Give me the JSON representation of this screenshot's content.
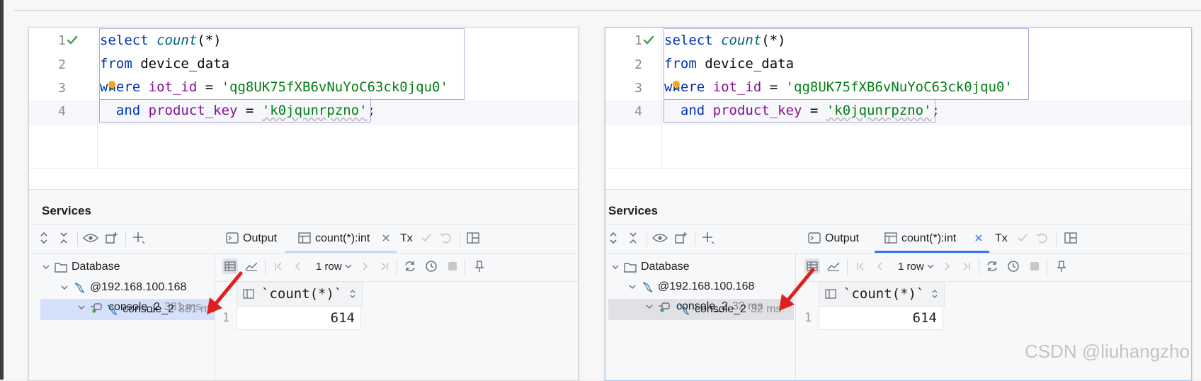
{
  "panels": [
    {
      "id": "left",
      "editor": {
        "line_numbers": [
          "1",
          "2",
          "3",
          "4"
        ],
        "lines": [
          [
            {
              "t": "select ",
              "c": "kw"
            },
            {
              "t": "count",
              "c": "fn"
            },
            {
              "t": "(*)",
              "c": ""
            }
          ],
          [
            {
              "t": "from ",
              "c": "kw"
            },
            {
              "t": "device_data",
              "c": ""
            }
          ],
          [
            {
              "t": "where ",
              "c": "kw"
            },
            {
              "t": "iot_id",
              "c": "col"
            },
            {
              "t": " = ",
              "c": ""
            },
            {
              "t": "'qg8UK75fXB6vNuYoC63ck0jqu0'",
              "c": "str"
            }
          ],
          [
            {
              "t": "  and ",
              "c": "kw"
            },
            {
              "t": "product_key",
              "c": "col"
            },
            {
              "t": " = ",
              "c": ""
            },
            {
              "t": "'k0jqunrpzno'",
              "c": "str wavy"
            },
            {
              "t": ";",
              "c": ""
            }
          ]
        ]
      },
      "services": {
        "title": "Services",
        "tabs": {
          "output": "Output",
          "result": "count(*):int",
          "tx": "Tx"
        },
        "row_count": "1 row",
        "tree": {
          "database": "Database",
          "host": "@192.168.100.168",
          "console_parent": "console_2",
          "console_parent_ms": "381 ms",
          "console_child": "console_2",
          "console_child_ms": "381 ms"
        },
        "grid": {
          "column": "`count(*)`",
          "row_number": "1",
          "value": "614"
        }
      }
    },
    {
      "id": "right",
      "editor": {
        "line_numbers": [
          "1",
          "2",
          "3",
          "4"
        ],
        "lines": [
          [
            {
              "t": "select ",
              "c": "kw"
            },
            {
              "t": "count",
              "c": "fn"
            },
            {
              "t": "(*)",
              "c": ""
            }
          ],
          [
            {
              "t": "from ",
              "c": "kw"
            },
            {
              "t": "device_data",
              "c": ""
            }
          ],
          [
            {
              "t": "where ",
              "c": "kw"
            },
            {
              "t": "iot_id",
              "c": "col"
            },
            {
              "t": " = ",
              "c": ""
            },
            {
              "t": "'qg8UK75fXB6vNuYoC63ck0jqu0'",
              "c": "str"
            }
          ],
          [
            {
              "t": "  and ",
              "c": "kw"
            },
            {
              "t": "product_key",
              "c": "col"
            },
            {
              "t": " = ",
              "c": ""
            },
            {
              "t": "'k0jqunrpzno'",
              "c": "str wavy"
            },
            {
              "t": ";",
              "c": ""
            }
          ]
        ]
      },
      "services": {
        "title": "Services",
        "tabs": {
          "output": "Output",
          "result": "count(*):int",
          "tx": "Tx"
        },
        "row_count": "1 row",
        "tree": {
          "database": "Database",
          "host": "@192.168.100.168",
          "console_parent": "console_2",
          "console_parent_ms": "32 ms",
          "console_child": "console_2",
          "console_child_ms": "32 ms"
        },
        "grid": {
          "column": "`count(*)`",
          "row_number": "1",
          "value": "614"
        }
      }
    }
  ],
  "watermark": "CSDN @liuhangzho",
  "colors": {
    "keyword": "#0033b3",
    "function": "#00627a",
    "column": "#871094",
    "string": "#067d17",
    "check": "#4aa05a",
    "arrow": "#e02020",
    "tab_underline": "#3574f0",
    "selection_left": "#d5e1fb",
    "selection_right": "#dfe1e5"
  }
}
